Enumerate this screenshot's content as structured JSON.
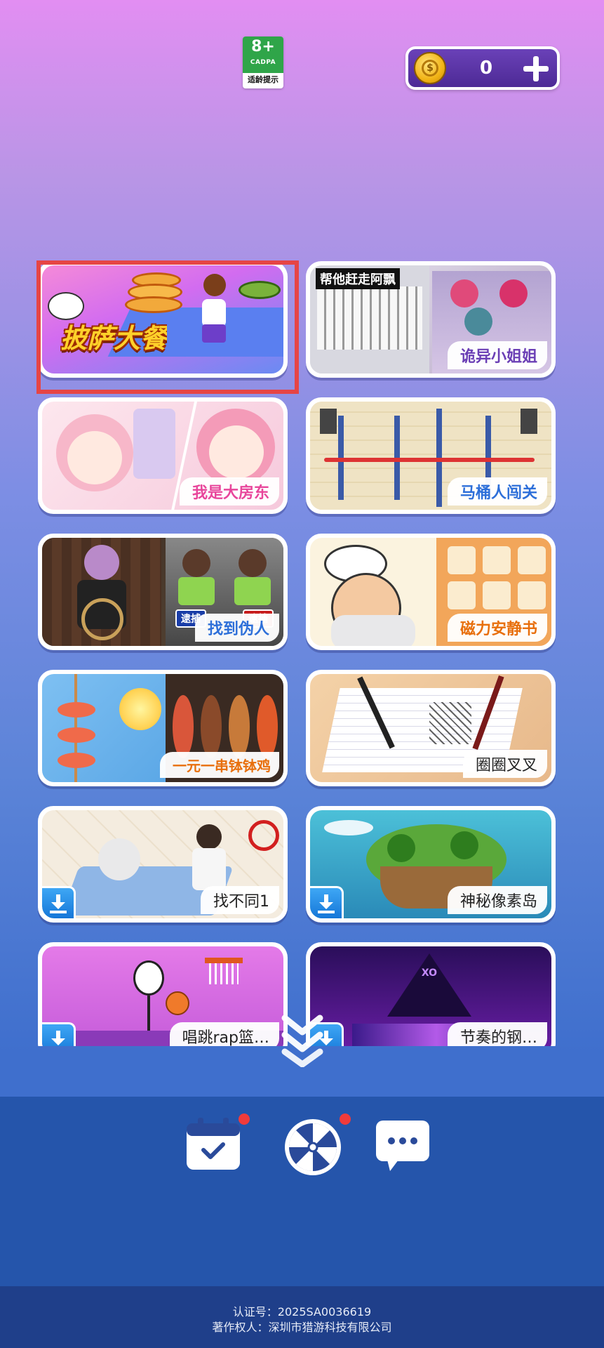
{
  "top_bar": {
    "age_rating": "8+",
    "age_org": "CADPA",
    "age_tip": "适龄提示",
    "coins": "0",
    "add_coin_icon": "plus-icon",
    "coin_icon": "coin-icon"
  },
  "games": [
    {
      "title": "披萨大餐",
      "download": false,
      "selected": true
    },
    {
      "title": "诡异小姐姐",
      "banner": "帮他赶走阿飘",
      "download": false
    },
    {
      "title": "我是大房东",
      "download": false
    },
    {
      "title": "马桶人闯关",
      "download": false
    },
    {
      "title": "找到伪人",
      "tags": [
        "逮捕",
        "逮捕"
      ],
      "download": false
    },
    {
      "title": "磁力安静书",
      "download": false
    },
    {
      "title": "一元一串钵钵鸡",
      "download": false
    },
    {
      "title": "圈圈叉叉",
      "download": false
    },
    {
      "title": "找不同1",
      "download": true
    },
    {
      "title": "神秘像素岛",
      "download": true
    },
    {
      "title": "唱跳rap篮…",
      "download": true
    },
    {
      "title": "节奏的钢…",
      "download": true
    }
  ],
  "bottom_nav": [
    {
      "icon": "calendar-check-icon",
      "has_dot": true
    },
    {
      "icon": "lucky-wheel-icon",
      "has_dot": true
    },
    {
      "icon": "chat-bubble-icon",
      "has_dot": false
    }
  ],
  "footer": {
    "cert_no": "认证号：2025SA0036619",
    "copyright": "著作权人：深圳市猎游科技有限公司"
  },
  "colors": {
    "accent_red": "#e64545",
    "nav_bar": "#2555ab",
    "footer_bg": "#1f3f8a"
  }
}
